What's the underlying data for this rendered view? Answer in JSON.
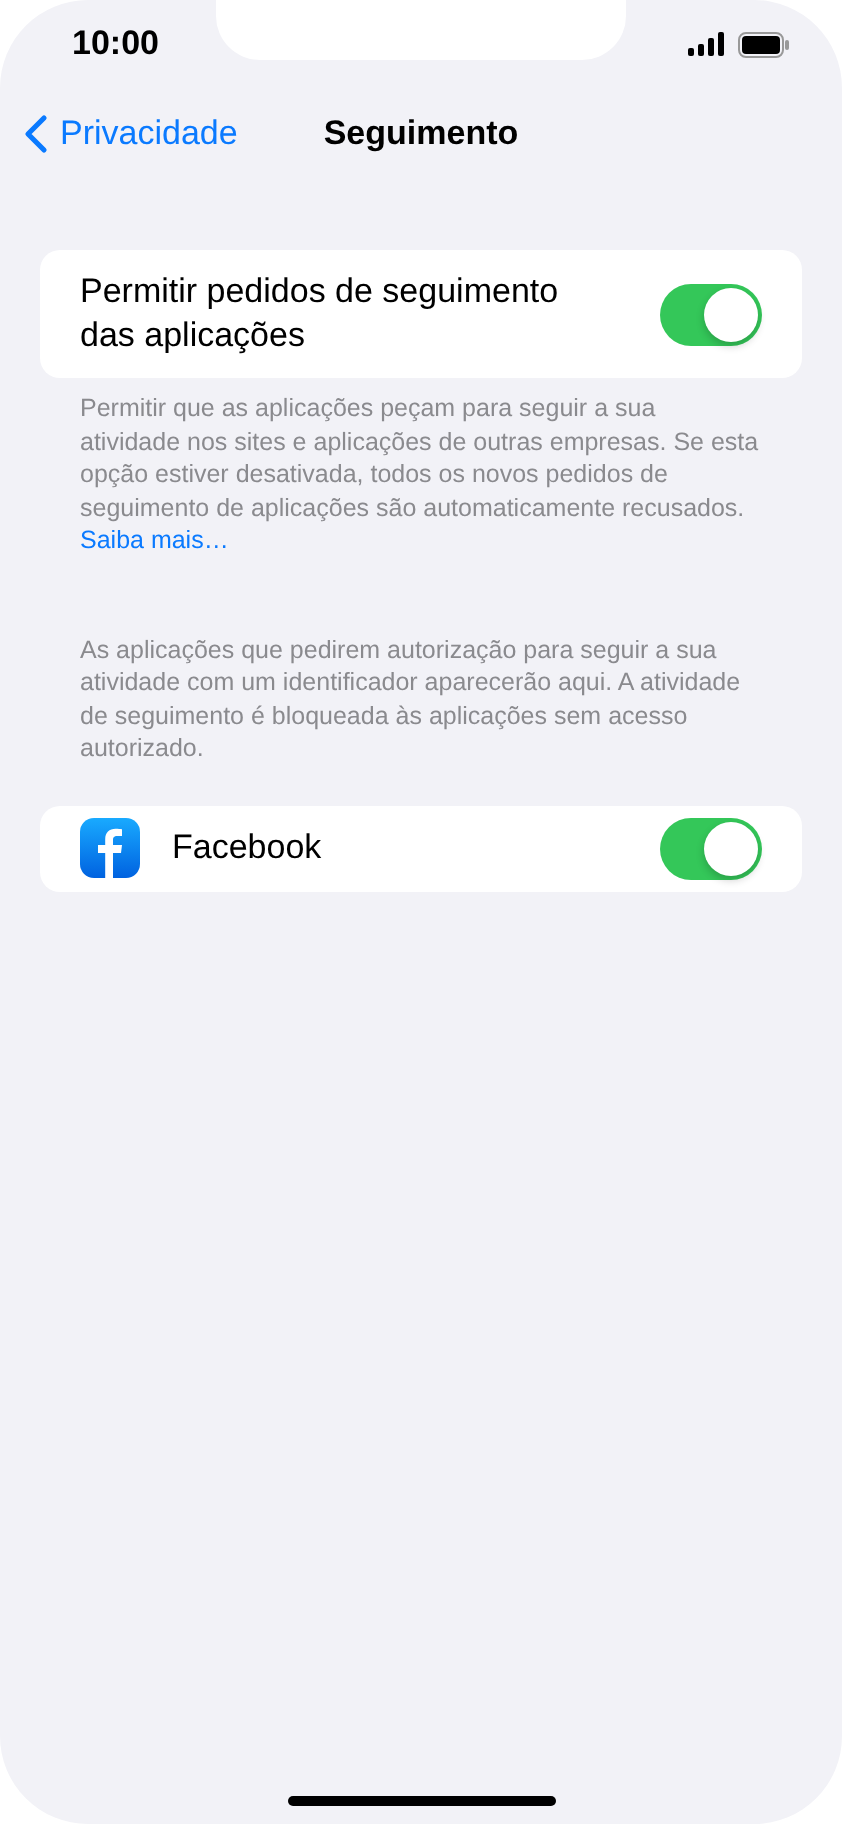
{
  "status_bar": {
    "time": "10:00"
  },
  "nav": {
    "back": "Privacidade",
    "title": "Seguimento"
  },
  "allow_tracking": {
    "label": "Permitir pedidos de seguimento das aplicações",
    "on": true
  },
  "allow_footer": {
    "text": "Permitir que as aplicações peçam para seguir a sua atividade nos sites e aplicações de outras empresas. Se esta opção estiver desativada, todos os novos pedidos de seguimento de aplicações são automaticamente recusados.",
    "link": "Saiba mais…"
  },
  "apps_footer": "As aplicações que pedirem autorização para seguir a sua atividade com um identificador aparecerão aqui. A atividade de seguimento é bloqueada às aplicações sem acesso autorizado.",
  "apps": [
    {
      "name": "Facebook",
      "on": true
    }
  ]
}
